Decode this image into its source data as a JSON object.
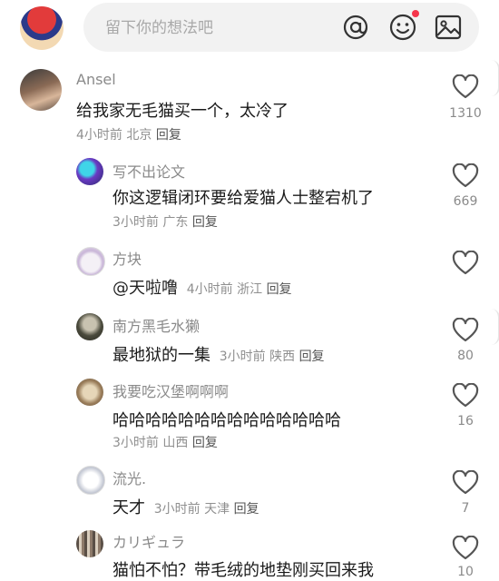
{
  "composer": {
    "placeholder": "留下你的想法吧",
    "icons": [
      "at-icon",
      "emoji-icon",
      "image-icon"
    ],
    "notification_dot_color": "#f5354b"
  },
  "comments": [
    {
      "name": "Ansel",
      "text": "给我家无毛猫买一个，太冷了",
      "time": "4小时前",
      "location": "北京",
      "reply": "回复",
      "likes": "1310"
    },
    {
      "name": "写不出论文",
      "text": "你这逻辑闭环要给爱猫人士整宕机了",
      "time": "3小时前",
      "location": "广东",
      "reply": "回复",
      "likes": "669"
    },
    {
      "name": "方块",
      "text": "@天啦噜",
      "time": "4小时前",
      "location": "浙江",
      "reply": "回复",
      "likes": ""
    },
    {
      "name": "南方黑毛水獭",
      "text": "最地狱的一集",
      "time": "3小时前",
      "location": "陕西",
      "reply": "回复",
      "likes": "80"
    },
    {
      "name": "我要吃汉堡啊啊啊",
      "text": "哈哈哈哈哈哈哈哈哈哈哈哈哈哈",
      "time": "3小时前",
      "location": "山西",
      "reply": "回复",
      "likes": "16"
    },
    {
      "name": "流光.",
      "text": "天才",
      "time": "3小时前",
      "location": "天津",
      "reply": "回复",
      "likes": "7"
    },
    {
      "name": "カリギュラ",
      "text": "猫怕不怕？带毛绒的地垫刚买回来我",
      "time": "",
      "location": "",
      "reply": "",
      "likes": "10"
    }
  ]
}
